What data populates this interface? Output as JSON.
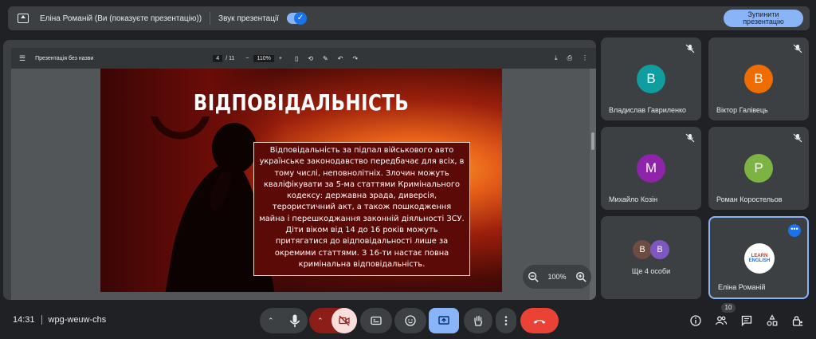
{
  "topbar": {
    "presenting_text": "Еліна Романій (Ви (показуєте презентацію))",
    "sound_label": "Звук презентації",
    "stop_button": "Зупинити презентацію"
  },
  "pdf_viewer": {
    "file_name": "Презентація без назви",
    "current_page": "4",
    "total_pages": "/ 11",
    "zoom": "110%",
    "zoom_overlay": "100%"
  },
  "slide": {
    "title": "ВІДПОВІДАЛЬНІСТЬ",
    "body": "Відповідальність за підпал військового авто українське законодавство передбачає для всіх, в тому числі, неповнолітніх. Злочин можуть кваліфікувати за 5-ма статтями Кримінального кодексу: державна зрада, диверсія, терористичний акт, а також пошкодження майна і перешкоджання законній діяльності ЗСУ. Діти віком від 14 до 16 років можуть притягатися до відповідальності лише за окремими статтями. З 16-ти настає повна кримінальна відповідальність."
  },
  "participants": [
    {
      "name": "Владислав Гавриленко",
      "initial": "В",
      "color": "#0f9d9f"
    },
    {
      "name": "Віктор Галівець",
      "initial": "В",
      "color": "#ef6c00"
    },
    {
      "name": "Михайло Козін",
      "initial": "М",
      "color": "#8e24aa"
    },
    {
      "name": "Роман Коростельов",
      "initial": "Р",
      "color": "#7cb342"
    }
  ],
  "others": {
    "label": "Ще 4 особи",
    "initials": [
      "В",
      "В"
    ],
    "colors": [
      "#6d4c41",
      "#7e57c2"
    ]
  },
  "self_tile": {
    "name": "Еліна Романій",
    "logo_line1": "LEARN",
    "logo_line2": "ENGLISH",
    "more": "•••"
  },
  "bottombar": {
    "time": "14:31",
    "meeting_code": "wpg-weuw-chs",
    "participant_count": "10"
  }
}
